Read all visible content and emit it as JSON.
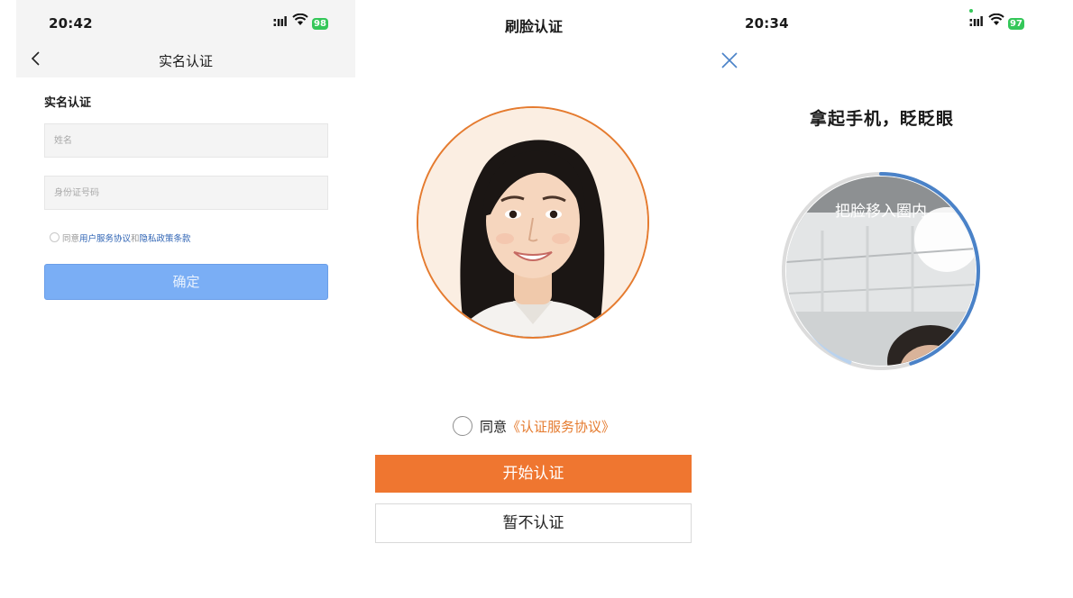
{
  "screens": {
    "form": {
      "status": {
        "time": "20:42",
        "battery": "98"
      },
      "nav_title": "实名认证",
      "section_title": "实名认证",
      "name_placeholder": "姓名",
      "id_placeholder": "身份证号码",
      "agree_prefix": "同意",
      "user_agreement": "用户服务协议",
      "agree_and": "和",
      "privacy_policy": "隐私政策条款",
      "confirm_label": "确定"
    },
    "face_intro": {
      "title": "刷脸认证",
      "agree_prefix": "同意",
      "agreement_link": "《认证服务协议》",
      "start_label": "开始认证",
      "skip_label": "暂不认证"
    },
    "face_scan": {
      "status": {
        "time": "20:34",
        "battery": "97"
      },
      "prompt": "拿起手机，眨眨眼",
      "camera_hint": "把脸移入圈内",
      "progress": 0.45
    }
  },
  "colors": {
    "accent_orange": "#ef7630",
    "confirm_blue": "#7aaef5",
    "link_blue": "#2f64b4",
    "progress_blue": "#4a82c8",
    "battery_green": "#34c759"
  },
  "icons": [
    "chevron-left-icon",
    "wifi-icon",
    "battery-icon",
    "close-icon",
    "radio-icon"
  ]
}
